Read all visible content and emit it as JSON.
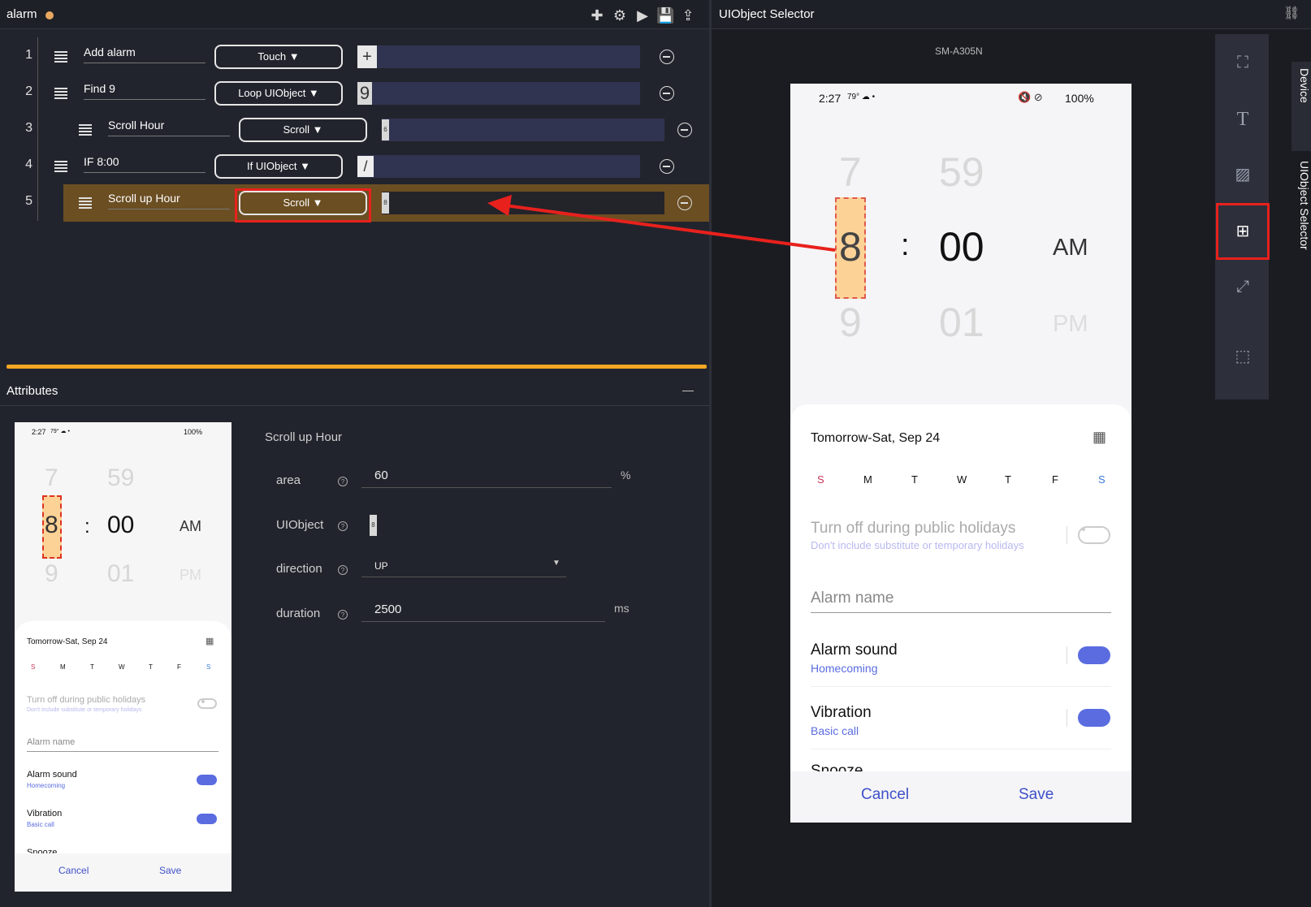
{
  "editor": {
    "title": "alarm",
    "toolbar": [
      "add-icon",
      "gear-icon",
      "play-icon",
      "save-icon",
      "export-icon"
    ],
    "steps": [
      {
        "num": "1",
        "label": "Add alarm",
        "action": "Touch ▼",
        "param": "+"
      },
      {
        "num": "2",
        "label": "Find 9",
        "action": "Loop UIObject ▼",
        "param": "9"
      },
      {
        "num": "3",
        "label": "Scroll Hour",
        "action": "Scroll ▼",
        "param": "6"
      },
      {
        "num": "4",
        "label": "IF 8:00",
        "action": "If UIObject ▼",
        "param": "/"
      },
      {
        "num": "5",
        "label": "Scroll up Hour",
        "action": "Scroll ▼",
        "param": "8"
      }
    ]
  },
  "attributes": {
    "header": "Attributes",
    "collapse": "—",
    "step_title": "Scroll up Hour",
    "area_label": "area",
    "area_value": "60",
    "area_unit": "%",
    "uiobject_label": "UIObject",
    "uiobject_value": "8",
    "direction_label": "direction",
    "direction_value": "UP",
    "duration_label": "duration",
    "duration_value": "2500",
    "duration_unit": "ms",
    "help": "?"
  },
  "selector": {
    "title": "UIObject Selector",
    "device": "SM-A305N",
    "tabs": [
      "Device",
      "UIObject Selector"
    ]
  },
  "phone": {
    "time": "2:27",
    "status_left": "79° ☁ •",
    "battery": "100%",
    "hours": [
      "7",
      "8",
      "9"
    ],
    "colon": ":",
    "minutes": [
      "59",
      "00",
      "01"
    ],
    "ampm": [
      "AM",
      "PM"
    ],
    "date": "Tomorrow-Sat, Sep 24",
    "days": [
      "S",
      "M",
      "T",
      "W",
      "T",
      "F",
      "S"
    ],
    "holiday_title": "Turn off during public holidays",
    "holiday_sub": "Don't include substitute or temporary holidays",
    "alarm_name": "Alarm name",
    "sound_title": "Alarm sound",
    "sound_sub": "Homecoming",
    "vibration_title": "Vibration",
    "vibration_sub": "Basic call",
    "snooze": "Snooze",
    "cancel": "Cancel",
    "save": "Save"
  },
  "colors": {
    "accent": "#f3a623",
    "selected_row": "#6b4e22",
    "highlight": "#e8211d",
    "phone_link": "#5a6ce0"
  }
}
